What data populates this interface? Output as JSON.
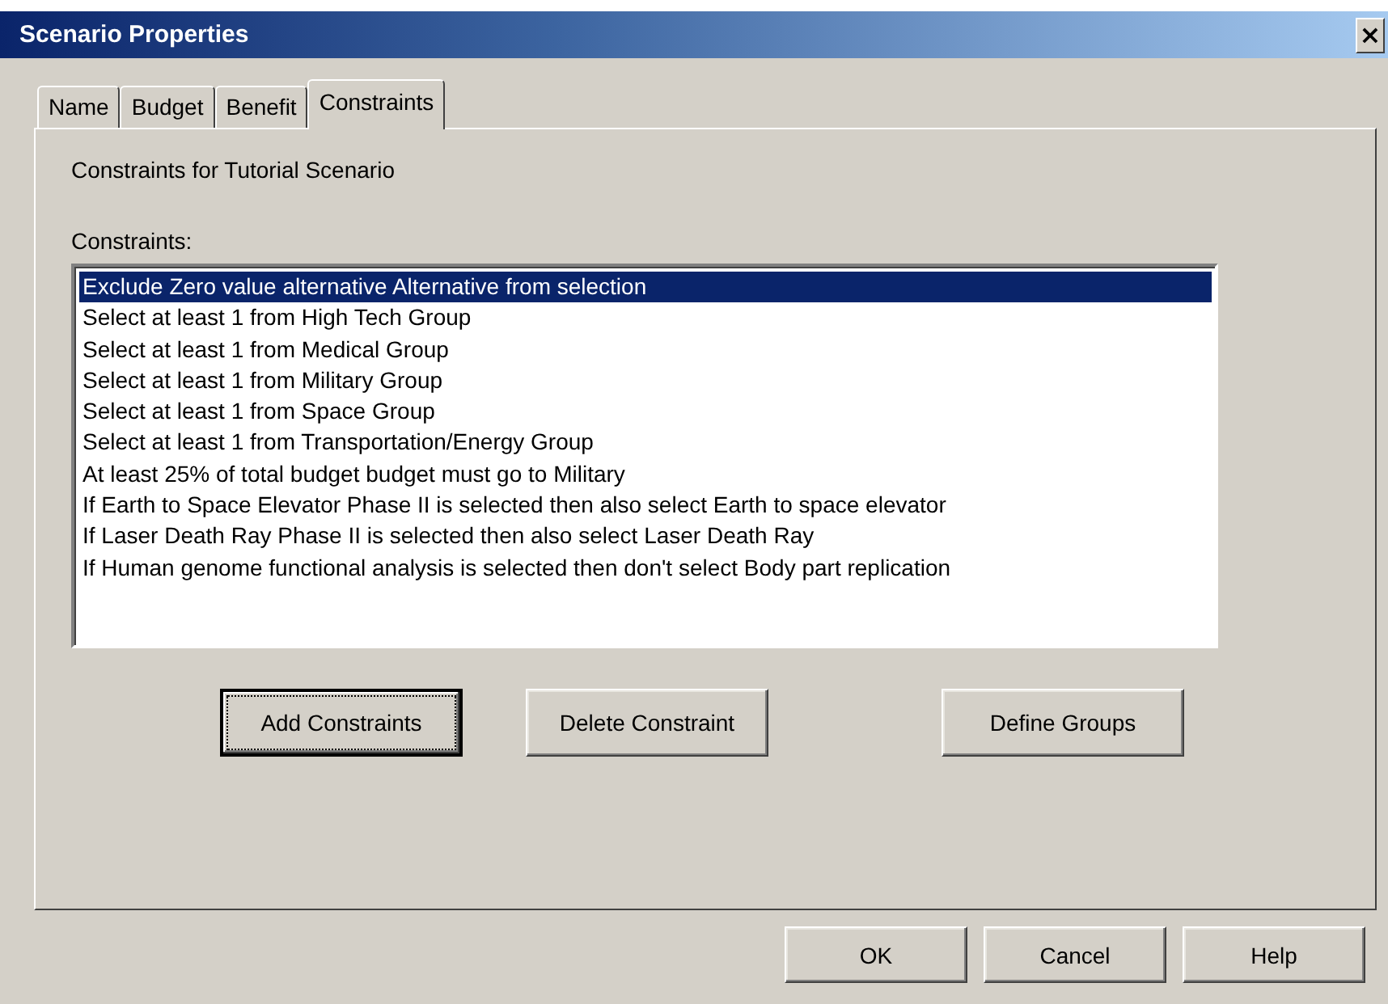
{
  "window": {
    "title": "Scenario Properties",
    "close": "×"
  },
  "tabs": [
    {
      "label": "Name",
      "selected": false
    },
    {
      "label": "Budget",
      "selected": false
    },
    {
      "label": "Benefit",
      "selected": false
    },
    {
      "label": "Constraints",
      "selected": true
    }
  ],
  "panel": {
    "heading": "Constraints for Tutorial Scenario",
    "list_label": "Constraints:",
    "constraints": [
      {
        "text": "Exclude Zero value alternative Alternative from selection",
        "selected": true
      },
      {
        "text": "Select at least 1 from High Tech Group",
        "selected": false
      },
      {
        "text": "Select at least 1 from Medical Group",
        "selected": false
      },
      {
        "text": "Select at least 1 from Military Group",
        "selected": false
      },
      {
        "text": "Select at least 1 from Space Group",
        "selected": false
      },
      {
        "text": "Select at least 1 from Transportation/Energy Group",
        "selected": false
      },
      {
        "text": "At least 25% of total budget budget must go to Military",
        "selected": false
      },
      {
        "text": "If Earth to Space Elevator Phase II is selected then also select Earth to space elevator",
        "selected": false
      },
      {
        "text": "If Laser Death Ray Phase II is selected then also select Laser Death Ray",
        "selected": false
      },
      {
        "text": "If Human genome functional analysis is selected then don't select Body part replication",
        "selected": false
      }
    ],
    "buttons": [
      {
        "label": "Add Constraints",
        "focused": true
      },
      {
        "label": "Delete Constraint",
        "focused": false
      },
      {
        "label": "Define Groups",
        "focused": false
      }
    ]
  },
  "footer_buttons": [
    {
      "label": "OK"
    },
    {
      "label": "Cancel"
    },
    {
      "label": "Help"
    }
  ]
}
